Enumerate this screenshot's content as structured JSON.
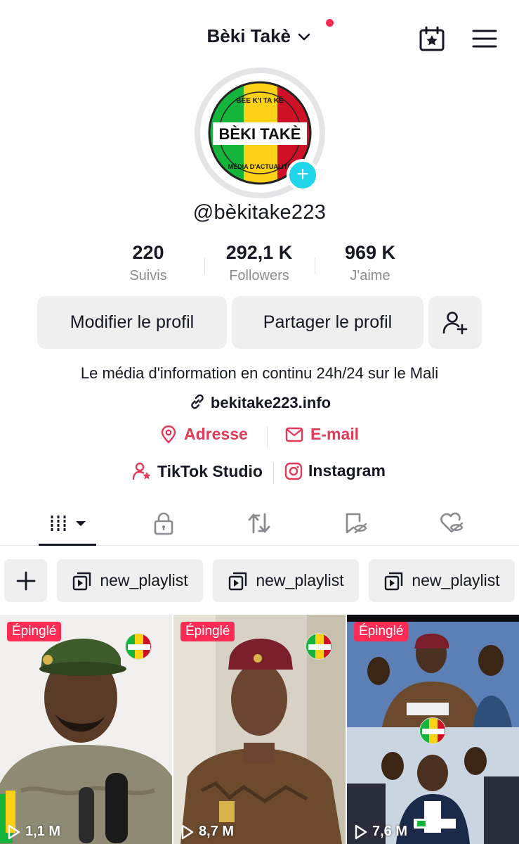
{
  "header": {
    "account_name": "Bèki Takè",
    "has_notification": true
  },
  "profile": {
    "username": "@bèkitake223",
    "avatar_title": "BÈKI TAKÈ",
    "avatar_top_text": "BÈE K'I TA KÈ",
    "avatar_bottom_text": "MÉDIA D'ACTUALITÉ"
  },
  "stats": [
    {
      "value": "220",
      "label": "Suivis"
    },
    {
      "value": "292,1 K",
      "label": "Followers"
    },
    {
      "value": "969 K",
      "label": "J'aime"
    }
  ],
  "buttons": {
    "edit": "Modifier le profil",
    "share": "Partager le profil"
  },
  "bio": {
    "text": "Le média d'information en continu 24h/24 sur le Mali",
    "link": "bekitake223.info"
  },
  "contacts": {
    "address": "Adresse",
    "email": "E-mail",
    "studio": "TikTok Studio",
    "instagram": "Instagram"
  },
  "playlists": [
    {
      "label": "new_playlist"
    },
    {
      "label": "new_playlist"
    },
    {
      "label": "new_playlist"
    }
  ],
  "videos": [
    {
      "pinned_label": "Épinglé",
      "views": "1,1 M"
    },
    {
      "pinned_label": "Épinglé",
      "views": "8,7 M"
    },
    {
      "pinned_label": "Épinglé",
      "views": "7,6 M"
    }
  ],
  "colors": {
    "accent_red": "#fe2c55",
    "contact_red": "#e23a57",
    "avatar_add": "#20d5ec",
    "mali_green": "#14b53a",
    "mali_yellow": "#fcd116",
    "mali_red": "#ce1126"
  }
}
